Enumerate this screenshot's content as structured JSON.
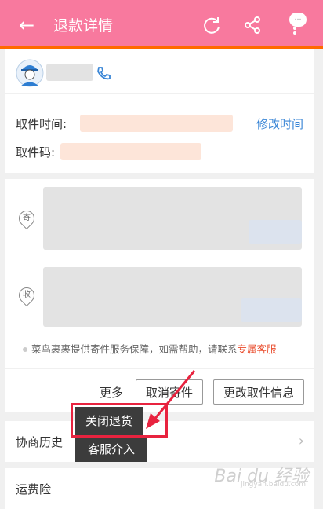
{
  "header": {
    "back_icon": "back-arrow-icon",
    "title": "退款详情",
    "refresh_icon": "refresh-icon",
    "share_icon": "share-icon",
    "more_icon": "more-vertical-icon",
    "bubble_text": "…"
  },
  "courier": {
    "avatar": "courier-avatar",
    "phone_icon": "phone-icon"
  },
  "pickup": {
    "time_label": "取件时间:",
    "modify_time": "修改时间",
    "code_label": "取件码:"
  },
  "address": {
    "sender_icon_text": "寄",
    "receiver_icon_text": "收"
  },
  "notice": {
    "text": "菜鸟裹裹提供寄件服务保障，如需帮助，请联系",
    "link": "专属客服"
  },
  "actions": {
    "more": "更多",
    "cancel": "取消寄件",
    "change": "更改取件信息"
  },
  "popup": {
    "close_refund": "关闭退货",
    "customer_service": "客服介入"
  },
  "rows": {
    "history": "协商历史",
    "freight": "运费险"
  },
  "watermark": {
    "main": "Bai du 经验",
    "sub": "jingyan.baidu.com"
  },
  "colors": {
    "header": "#f8799e",
    "accent_line": "#ff6a00",
    "link": "#3a86d6",
    "highlight": "#e8233f"
  }
}
